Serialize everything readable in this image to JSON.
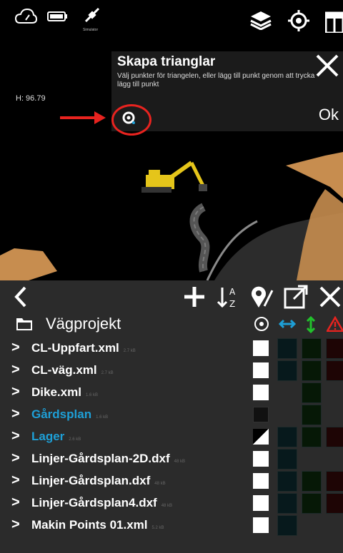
{
  "status_bar": {
    "icons": [
      "cloud-gauge-icon",
      "battery-icon",
      "satellite-icon",
      "layers-icon",
      "locate-icon",
      "map-icon"
    ],
    "satellite_label": "Simulator"
  },
  "scene": {
    "height_label": "H: 96.79"
  },
  "dialog": {
    "title": "Skapa trianglar",
    "message": "Välj punkter för triangelen, eller lägg till punkt genom att trycka lägg till punkt",
    "ok_label": "Ok"
  },
  "panel": {
    "project_title": "Vägprojekt",
    "files": [
      {
        "name": "CL-Uppfart.xml",
        "meta": "2.7 kB",
        "color": "#ffffff",
        "check": "on",
        "cols": [
          true,
          true,
          true
        ]
      },
      {
        "name": "CL-väg.xml",
        "meta": "2.7 kB",
        "color": "#ffffff",
        "check": "on",
        "cols": [
          true,
          true,
          true
        ]
      },
      {
        "name": "Dike.xml",
        "meta": "1.6 kB",
        "color": "#ffffff",
        "check": "on",
        "cols": [
          false,
          true,
          false
        ]
      },
      {
        "name": "Gårdsplan",
        "meta": "1.6 kB",
        "color": "#1e9fd6",
        "check": "off",
        "cols": [
          false,
          true,
          false
        ]
      },
      {
        "name": "Lager",
        "meta": "2.6 kB",
        "color": "#1e9fd6",
        "check": "partial",
        "cols": [
          true,
          true,
          true
        ]
      },
      {
        "name": "Linjer-Gårdsplan-2D.dxf",
        "meta": "48 kB",
        "color": "#ffffff",
        "check": "on",
        "cols": [
          true,
          false,
          false
        ]
      },
      {
        "name": "Linjer-Gårdsplan.dxf",
        "meta": "48 kB",
        "color": "#ffffff",
        "check": "on",
        "cols": [
          true,
          true,
          true
        ]
      },
      {
        "name": "Linjer-Gårdsplan4.dxf",
        "meta": "48 kB",
        "color": "#ffffff",
        "check": "on",
        "cols": [
          true,
          true,
          true
        ]
      },
      {
        "name": "Makin Points 01.xml",
        "meta": "5.2 kB",
        "color": "#ffffff",
        "check": "on",
        "cols": [
          true,
          false,
          false
        ]
      }
    ]
  }
}
